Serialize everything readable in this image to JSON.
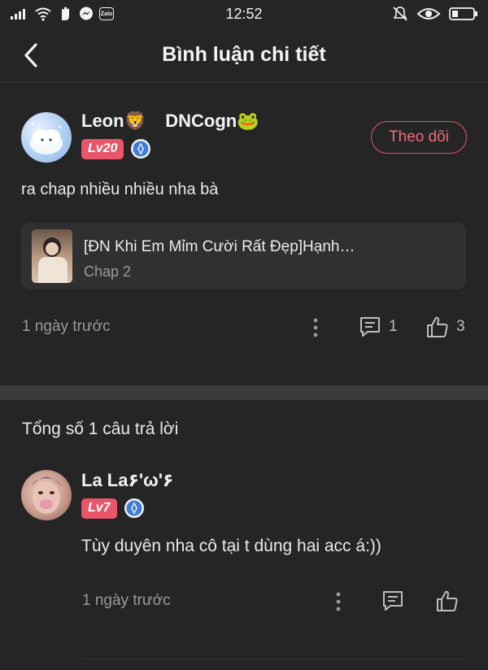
{
  "status_bar": {
    "time": "12:52",
    "zalo_label": "Zalo"
  },
  "header": {
    "title": "Bình luận chi tiết"
  },
  "comment": {
    "username": "Leon🦁 ⠀DNCogn🐸",
    "level": "Lv20",
    "follow_label": "Theo dõi",
    "text": "ra chap nhiều nhiều nha bà",
    "story": {
      "title": "[ĐN Khi Em Mỉm Cười Rất Đẹp]Hạnh…",
      "chapter": "Chap 2"
    },
    "time": "1 ngày trước",
    "reply_count": "1",
    "like_count": "3"
  },
  "replies_header": "Tổng số 1 câu trả lời",
  "reply": {
    "username": "La La۶'ω'۶",
    "level": "Lv7",
    "text": "Tùy duyên nha cô tại t dùng hai acc á:))",
    "time": "1 ngày trước"
  },
  "colors": {
    "background": "#252525",
    "accent": "#e9566a",
    "verify": "#3f7fd8"
  },
  "icons": [
    "signal-icon",
    "wifi-icon",
    "hand-icon",
    "messenger-icon",
    "mute-icon",
    "eye-icon",
    "battery-icon",
    "back-arrow-icon",
    "verified-icon",
    "more-vertical-icon",
    "comment-icon",
    "thumbs-up-icon"
  ]
}
